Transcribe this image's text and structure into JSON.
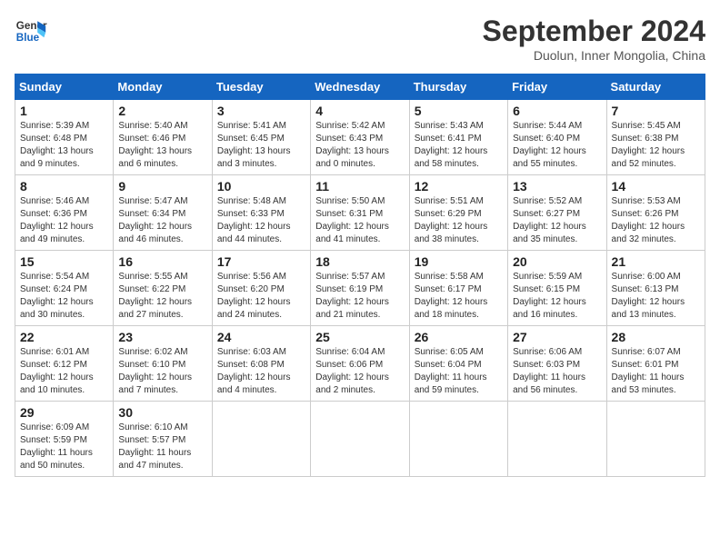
{
  "header": {
    "logo_general": "General",
    "logo_blue": "Blue",
    "month_title": "September 2024",
    "location": "Duolun, Inner Mongolia, China"
  },
  "weekdays": [
    "Sunday",
    "Monday",
    "Tuesday",
    "Wednesday",
    "Thursday",
    "Friday",
    "Saturday"
  ],
  "weeks": [
    [
      {
        "day": "1",
        "sunrise": "5:39 AM",
        "sunset": "6:48 PM",
        "daylight": "13 hours and 9 minutes."
      },
      {
        "day": "2",
        "sunrise": "5:40 AM",
        "sunset": "6:46 PM",
        "daylight": "13 hours and 6 minutes."
      },
      {
        "day": "3",
        "sunrise": "5:41 AM",
        "sunset": "6:45 PM",
        "daylight": "13 hours and 3 minutes."
      },
      {
        "day": "4",
        "sunrise": "5:42 AM",
        "sunset": "6:43 PM",
        "daylight": "13 hours and 0 minutes."
      },
      {
        "day": "5",
        "sunrise": "5:43 AM",
        "sunset": "6:41 PM",
        "daylight": "12 hours and 58 minutes."
      },
      {
        "day": "6",
        "sunrise": "5:44 AM",
        "sunset": "6:40 PM",
        "daylight": "12 hours and 55 minutes."
      },
      {
        "day": "7",
        "sunrise": "5:45 AM",
        "sunset": "6:38 PM",
        "daylight": "12 hours and 52 minutes."
      }
    ],
    [
      {
        "day": "8",
        "sunrise": "5:46 AM",
        "sunset": "6:36 PM",
        "daylight": "12 hours and 49 minutes."
      },
      {
        "day": "9",
        "sunrise": "5:47 AM",
        "sunset": "6:34 PM",
        "daylight": "12 hours and 46 minutes."
      },
      {
        "day": "10",
        "sunrise": "5:48 AM",
        "sunset": "6:33 PM",
        "daylight": "12 hours and 44 minutes."
      },
      {
        "day": "11",
        "sunrise": "5:50 AM",
        "sunset": "6:31 PM",
        "daylight": "12 hours and 41 minutes."
      },
      {
        "day": "12",
        "sunrise": "5:51 AM",
        "sunset": "6:29 PM",
        "daylight": "12 hours and 38 minutes."
      },
      {
        "day": "13",
        "sunrise": "5:52 AM",
        "sunset": "6:27 PM",
        "daylight": "12 hours and 35 minutes."
      },
      {
        "day": "14",
        "sunrise": "5:53 AM",
        "sunset": "6:26 PM",
        "daylight": "12 hours and 32 minutes."
      }
    ],
    [
      {
        "day": "15",
        "sunrise": "5:54 AM",
        "sunset": "6:24 PM",
        "daylight": "12 hours and 30 minutes."
      },
      {
        "day": "16",
        "sunrise": "5:55 AM",
        "sunset": "6:22 PM",
        "daylight": "12 hours and 27 minutes."
      },
      {
        "day": "17",
        "sunrise": "5:56 AM",
        "sunset": "6:20 PM",
        "daylight": "12 hours and 24 minutes."
      },
      {
        "day": "18",
        "sunrise": "5:57 AM",
        "sunset": "6:19 PM",
        "daylight": "12 hours and 21 minutes."
      },
      {
        "day": "19",
        "sunrise": "5:58 AM",
        "sunset": "6:17 PM",
        "daylight": "12 hours and 18 minutes."
      },
      {
        "day": "20",
        "sunrise": "5:59 AM",
        "sunset": "6:15 PM",
        "daylight": "12 hours and 16 minutes."
      },
      {
        "day": "21",
        "sunrise": "6:00 AM",
        "sunset": "6:13 PM",
        "daylight": "12 hours and 13 minutes."
      }
    ],
    [
      {
        "day": "22",
        "sunrise": "6:01 AM",
        "sunset": "6:12 PM",
        "daylight": "12 hours and 10 minutes."
      },
      {
        "day": "23",
        "sunrise": "6:02 AM",
        "sunset": "6:10 PM",
        "daylight": "12 hours and 7 minutes."
      },
      {
        "day": "24",
        "sunrise": "6:03 AM",
        "sunset": "6:08 PM",
        "daylight": "12 hours and 4 minutes."
      },
      {
        "day": "25",
        "sunrise": "6:04 AM",
        "sunset": "6:06 PM",
        "daylight": "12 hours and 2 minutes."
      },
      {
        "day": "26",
        "sunrise": "6:05 AM",
        "sunset": "6:04 PM",
        "daylight": "11 hours and 59 minutes."
      },
      {
        "day": "27",
        "sunrise": "6:06 AM",
        "sunset": "6:03 PM",
        "daylight": "11 hours and 56 minutes."
      },
      {
        "day": "28",
        "sunrise": "6:07 AM",
        "sunset": "6:01 PM",
        "daylight": "11 hours and 53 minutes."
      }
    ],
    [
      {
        "day": "29",
        "sunrise": "6:09 AM",
        "sunset": "5:59 PM",
        "daylight": "11 hours and 50 minutes."
      },
      {
        "day": "30",
        "sunrise": "6:10 AM",
        "sunset": "5:57 PM",
        "daylight": "11 hours and 47 minutes."
      },
      null,
      null,
      null,
      null,
      null
    ]
  ]
}
